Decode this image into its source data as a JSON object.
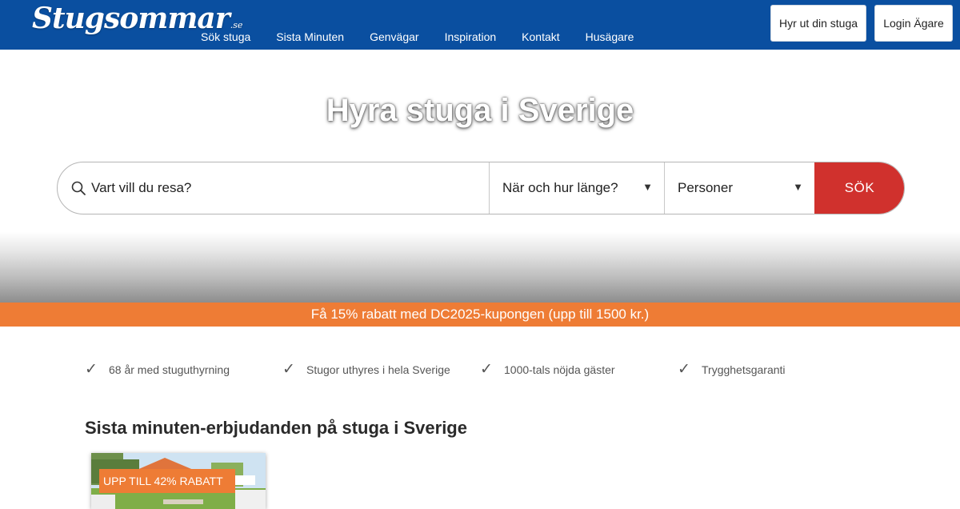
{
  "header": {
    "logo_text": "Stugsommar",
    "logo_suffix": ".se",
    "nav": [
      "Sök stuga",
      "Sista Minuten",
      "Genvägar",
      "Inspiration",
      "Kontakt",
      "Husägare"
    ],
    "rent_out_button": "Hyr ut din stuga",
    "login_button": "Login Ägare",
    "brand_color": "#0a4fa0"
  },
  "hero": {
    "title": "Hyra stuga i Sverige"
  },
  "search": {
    "destination_placeholder": "Vart vill du resa?",
    "dates_label": "När och hur länge?",
    "persons_label": "Personer",
    "submit_label": "SÖK",
    "submit_color": "#d0312d",
    "search_icon": "search-icon",
    "dropdown_icon": "triangle-down-icon"
  },
  "promo": {
    "text": "Få 15% rabatt med DC2025-kupongen (upp till 1500 kr.)",
    "color": "#ee7c35"
  },
  "features": {
    "icon": "check-icon",
    "items": [
      "68 år med stuguthyrning",
      "Stugor uthyres i hela Sverige",
      "1000-tals nöjda gäster",
      "Trygghetsgaranti"
    ]
  },
  "last_minute": {
    "title": "Sista minuten-erbjudanden på stuga i Sverige",
    "cards": [
      {
        "badge": "UPP TILL 42% RABATT"
      }
    ]
  }
}
